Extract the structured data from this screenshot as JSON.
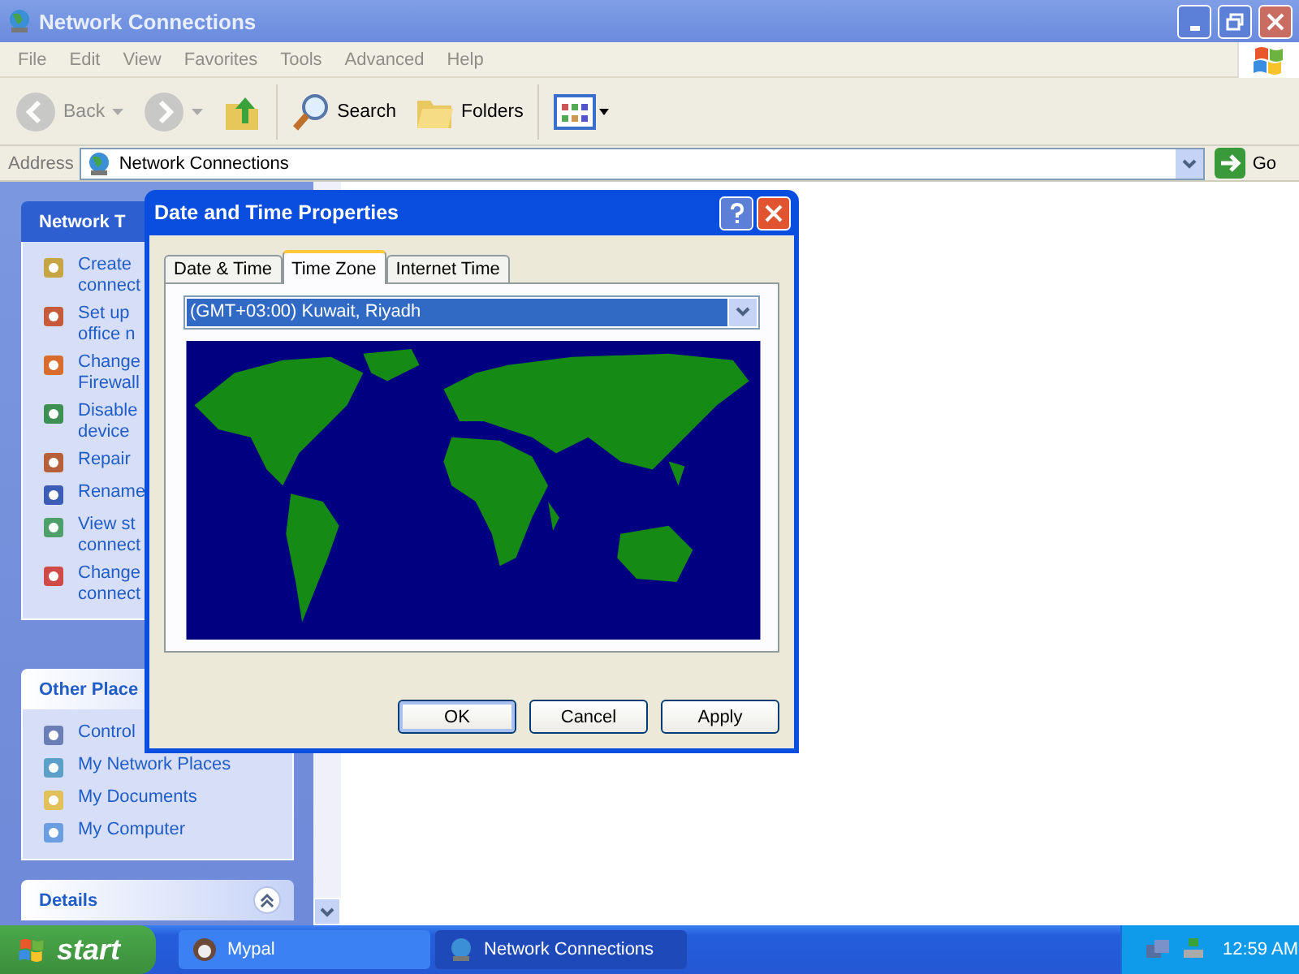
{
  "window": {
    "title": "Network Connections"
  },
  "menu": [
    "File",
    "Edit",
    "View",
    "Favorites",
    "Tools",
    "Advanced",
    "Help"
  ],
  "toolbar": [
    {
      "kind": "back",
      "label": "Back"
    },
    {
      "kind": "forward"
    },
    {
      "kind": "up"
    },
    {
      "kind": "search",
      "label": "Search"
    },
    {
      "kind": "folders",
      "label": "Folders"
    },
    {
      "kind": "views"
    }
  ],
  "address": {
    "label": "Address",
    "value": "Network Connections",
    "go": "Go"
  },
  "sidebar": [
    {
      "title": "Network T",
      "items": [
        {
          "lines": [
            "Create",
            "connect"
          ]
        },
        {
          "lines": [
            "Set up",
            "office n"
          ]
        },
        {
          "lines": [
            "Change",
            "Firewall"
          ]
        },
        {
          "lines": [
            "Disable",
            "device"
          ]
        },
        {
          "lines": [
            "Repair"
          ]
        },
        {
          "lines": [
            "Rename"
          ]
        },
        {
          "lines": [
            "View st",
            "connect"
          ]
        },
        {
          "lines": [
            "Change",
            "connect"
          ]
        }
      ]
    },
    {
      "title": "Other Place",
      "items": [
        {
          "lines": [
            "Control"
          ]
        },
        {
          "lines": [
            "My Network Places"
          ]
        },
        {
          "lines": [
            "My Documents"
          ]
        },
        {
          "lines": [
            "My Computer"
          ]
        }
      ]
    },
    {
      "title": "Details"
    }
  ],
  "dialog": {
    "title": "Date and Time Properties",
    "tabs": [
      {
        "label": "Date & Time",
        "selected": false
      },
      {
        "label": "Time Zone",
        "selected": true
      },
      {
        "label": "Internet Time",
        "selected": false
      }
    ],
    "timezone": {
      "value": "(GMT+03:00) Kuwait, Riyadh"
    },
    "buttons": [
      {
        "label": "OK",
        "default": true
      },
      {
        "label": "Cancel",
        "default": false
      },
      {
        "label": "Apply",
        "default": false
      }
    ]
  },
  "taskbar": {
    "start": "start",
    "tasks": [
      {
        "label": "Mypal",
        "selected": false
      },
      {
        "label": "Network Connections",
        "selected": true
      }
    ],
    "clock": "12:59 AM"
  }
}
